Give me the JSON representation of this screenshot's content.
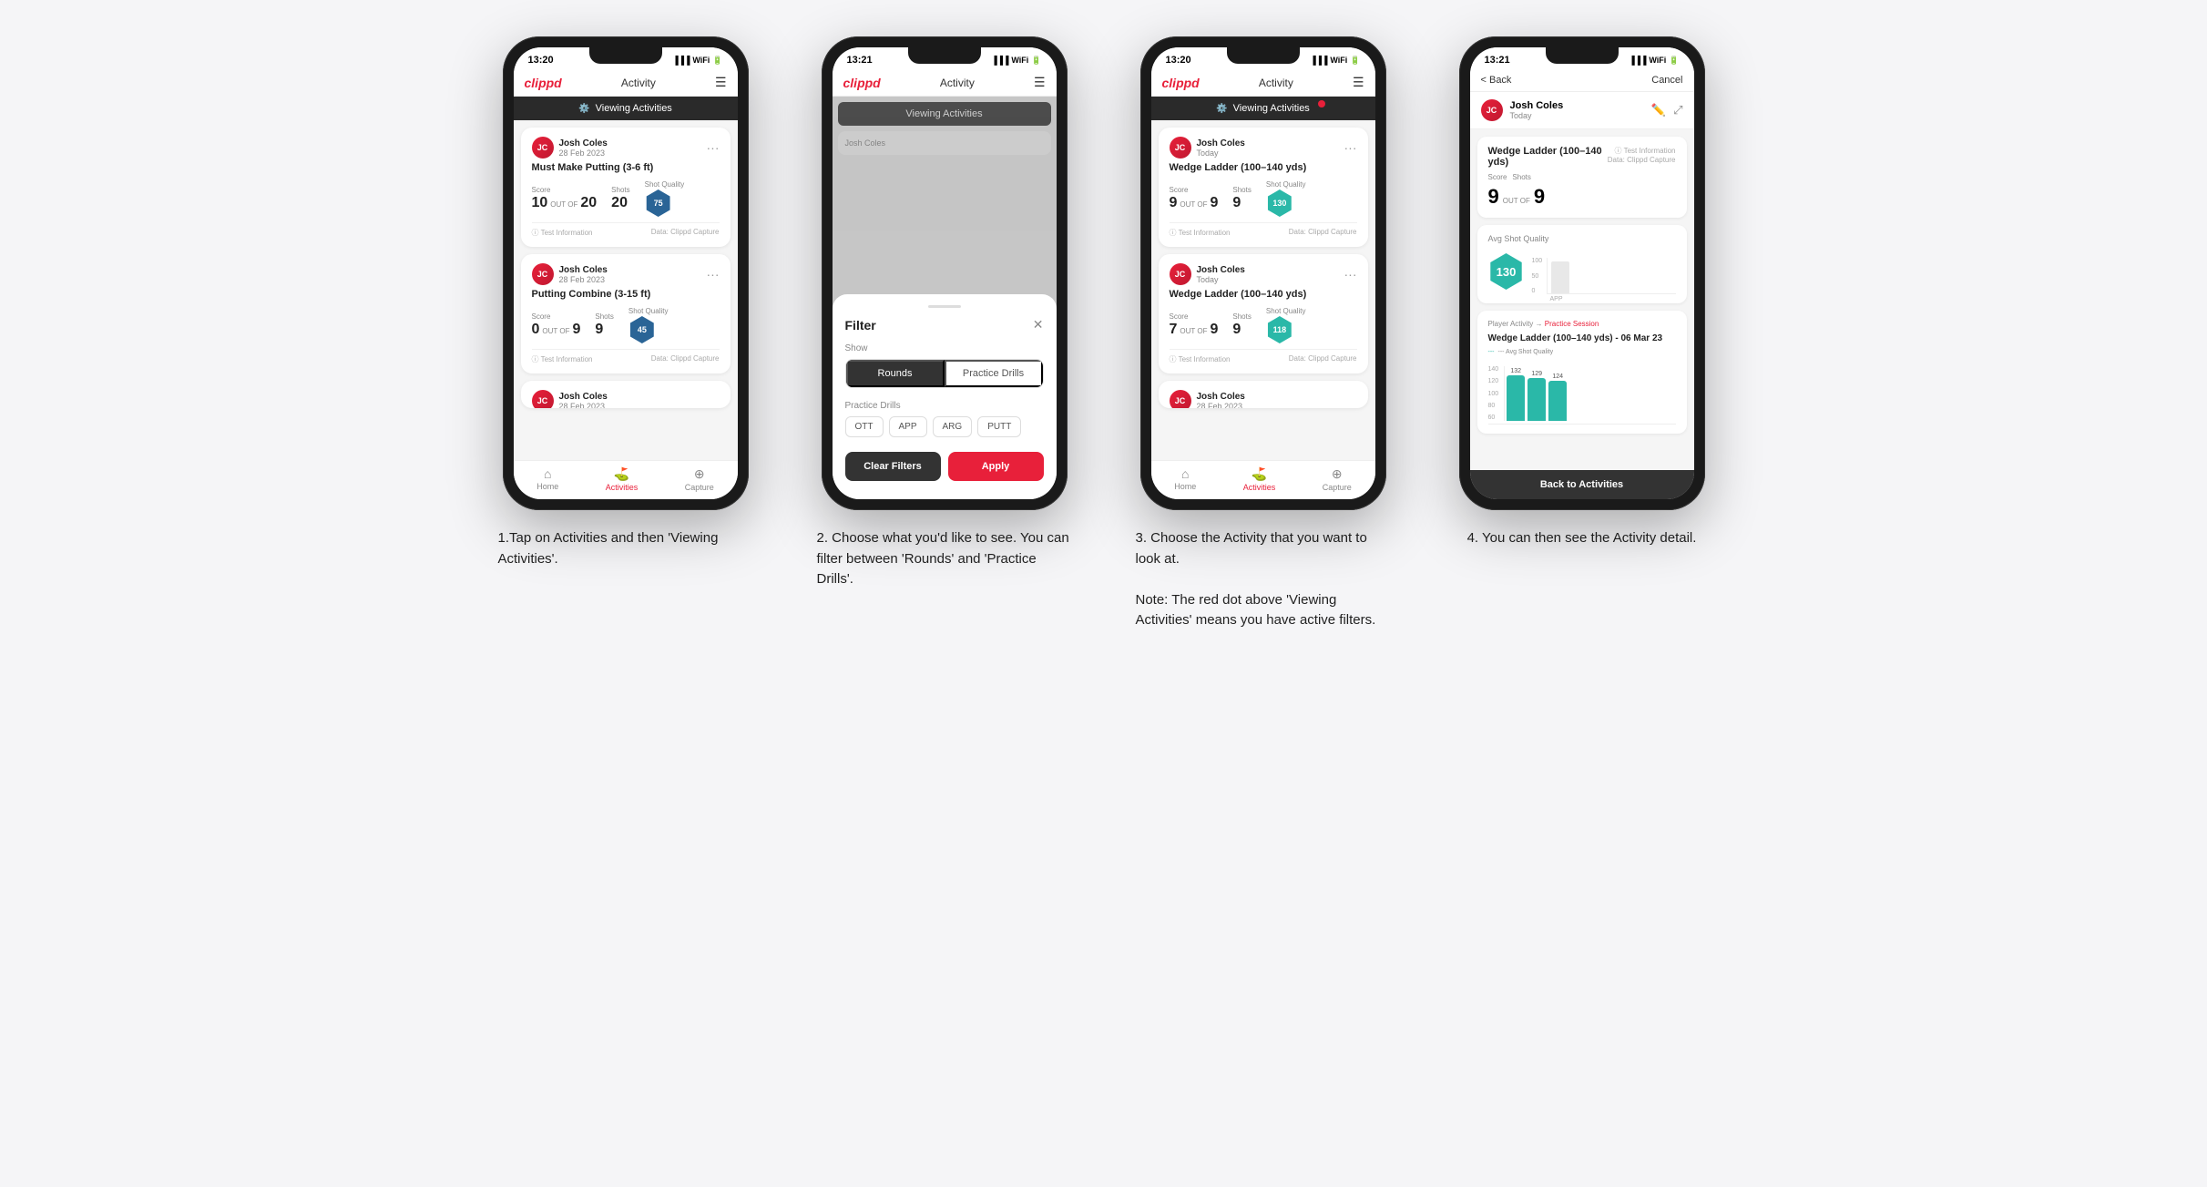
{
  "steps": [
    {
      "id": "step1",
      "description": "1.Tap on Activities and then 'Viewing Activities'.",
      "phone": {
        "statusTime": "13:20",
        "appTitle": "Activity",
        "logo": "clippd",
        "banner": "Viewing Activities",
        "hasRedDot": false,
        "cards": [
          {
            "name": "Josh Coles",
            "date": "28 Feb 2023",
            "title": "Must Make Putting (3-6 ft)",
            "score": "10",
            "outOf": "20",
            "shots": "20",
            "shotQuality": "75",
            "shotQualityType": "hex"
          },
          {
            "name": "Josh Coles",
            "date": "28 Feb 2023",
            "title": "Putting Combine (3-15 ft)",
            "score": "0",
            "outOf": "9",
            "shots": "9",
            "shotQuality": "45",
            "shotQualityType": "hex"
          },
          {
            "name": "Josh Coles",
            "date": "28 Feb 2023",
            "title": "",
            "score": "",
            "outOf": "",
            "shots": "",
            "shotQuality": "",
            "shotQualityType": ""
          }
        ]
      }
    },
    {
      "id": "step2",
      "description": "2. Choose what you'd like to see. You can filter between 'Rounds' and 'Practice Drills'.",
      "phone": {
        "statusTime": "13:21",
        "appTitle": "Activity",
        "logo": "clippd",
        "banner": "Viewing Activities",
        "hasRedDot": false,
        "filter": {
          "title": "Filter",
          "showLabel": "Show",
          "toggleRounds": "Rounds",
          "togglePractice": "Practice Drills",
          "activeToggle": "rounds",
          "practiceDrillsLabel": "Practice Drills",
          "chips": [
            "OTT",
            "APP",
            "ARG",
            "PUTT"
          ],
          "clearBtn": "Clear Filters",
          "applyBtn": "Apply"
        }
      }
    },
    {
      "id": "step3",
      "description": "3. Choose the Activity that you want to look at.\n\nNote: The red dot above 'Viewing Activities' means you have active filters.",
      "phone": {
        "statusTime": "13:20",
        "appTitle": "Activity",
        "logo": "clippd",
        "banner": "Viewing Activities",
        "hasRedDot": true,
        "cards": [
          {
            "name": "Josh Coles",
            "date": "Today",
            "title": "Wedge Ladder (100–140 yds)",
            "score": "9",
            "outOf": "9",
            "shots": "9",
            "shotQuality": "130",
            "shotQualityType": "hex-teal"
          },
          {
            "name": "Josh Coles",
            "date": "Today",
            "title": "Wedge Ladder (100–140 yds)",
            "score": "7",
            "outOf": "9",
            "shots": "9",
            "shotQuality": "118",
            "shotQualityType": "hex-teal"
          },
          {
            "name": "Josh Coles",
            "date": "28 Feb 2023",
            "title": "",
            "score": "",
            "outOf": "",
            "shots": "",
            "shotQuality": "",
            "shotQualityType": ""
          }
        ]
      }
    },
    {
      "id": "step4",
      "description": "4. You can then see the Activity detail.",
      "phone": {
        "statusTime": "13:21",
        "backLabel": "< Back",
        "cancelLabel": "Cancel",
        "userName": "Josh Coles",
        "userDate": "Today",
        "drillTitle": "Wedge Ladder (100–140 yds)",
        "scoreLabel": "Score",
        "shotsLabel": "Shots",
        "scoreValue": "9",
        "outOf": "OUT OF",
        "shotsValue": "9",
        "avgQualityLabel": "Avg Shot Quality",
        "avgQualityValue": "130",
        "chartBars": [
          130
        ],
        "chartLabel": "APP",
        "yLabels": [
          "100",
          "50",
          "0"
        ],
        "sessionLabel": "Player Activity",
        "sessionType": "Practice Session",
        "historyTitle": "Wedge Ladder (100–140 yds) - 06 Mar 23",
        "historySubtitle": "--- Avg Shot Quality",
        "historyBars": [
          {
            "value": "132",
            "type": "green"
          },
          {
            "value": "129",
            "type": "green"
          },
          {
            "value": "124",
            "type": "green"
          }
        ],
        "backToActivities": "Back to Activities"
      }
    }
  ]
}
